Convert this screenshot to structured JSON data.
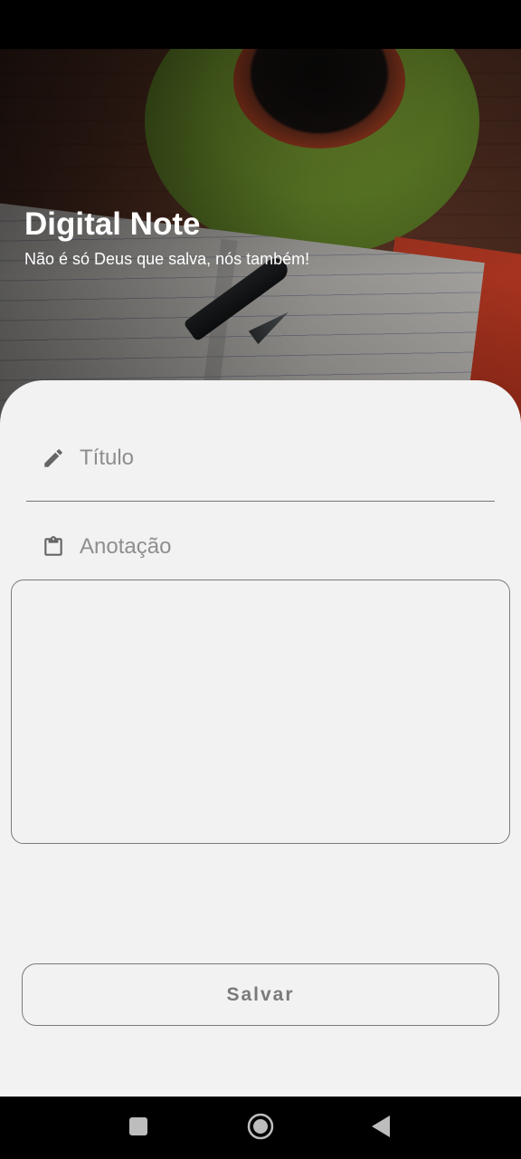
{
  "header": {
    "title": "Digital Note",
    "subtitle": "Não é só Deus que salva, nós também!"
  },
  "form": {
    "title_field": {
      "placeholder": "Título",
      "value": "",
      "icon": "pencil-icon"
    },
    "note_field": {
      "label": "Anotação",
      "value": "",
      "icon": "clipboard-icon"
    },
    "save_label": "Salvar"
  },
  "navigation": {
    "recents_icon": "square-icon",
    "home_icon": "circle-icon",
    "back_icon": "triangle-back-icon"
  },
  "colors": {
    "card_background": "#f2f2f2",
    "outline": "#7a7a7a",
    "placeholder": "#8e8e8e",
    "header_text": "#ffffff"
  }
}
